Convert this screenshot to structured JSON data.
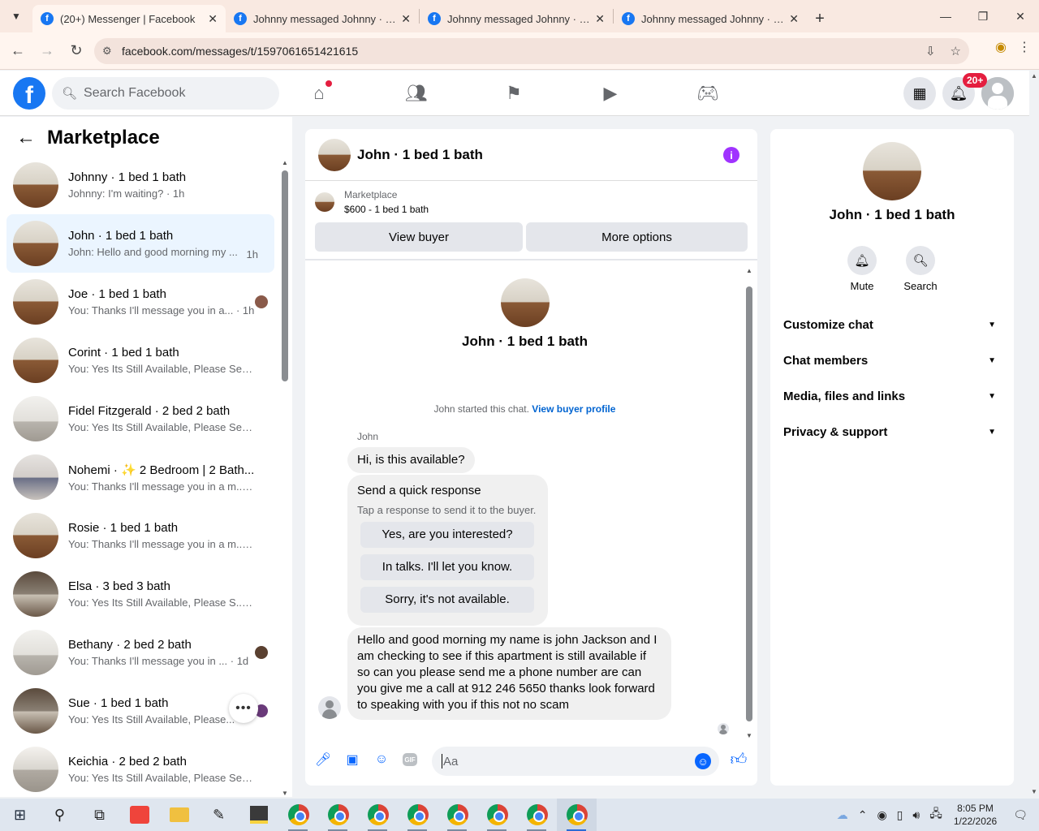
{
  "browser": {
    "tabs": [
      {
        "title": "(20+) Messenger | Facebook",
        "active": true
      },
      {
        "title": "Johnny messaged Johnny · 1 bed 1 bath",
        "active": false
      },
      {
        "title": "Johnny messaged Johnny · 1 bed 1 bath",
        "active": false
      },
      {
        "title": "Johnny messaged Johnny · 1 bed 1 bath",
        "active": false
      }
    ],
    "url": "facebook.com/messages/t/1597061651421615"
  },
  "fb_header": {
    "search_placeholder": "Search Facebook",
    "notification_badge": "20+"
  },
  "sidebar": {
    "title": "Marketplace",
    "conversations": [
      {
        "name": "Johnny · 1 bed 1 bath",
        "preview": "Johnny: I'm waiting? · 1h",
        "time": "",
        "thumb": "room"
      },
      {
        "name": "John · 1 bed 1 bath",
        "preview": "John: Hello and good morning my ...",
        "time": "1h",
        "thumb": "room",
        "selected": true
      },
      {
        "name": "Joe · 1 bed 1 bath",
        "preview": "You: Thanks I'll message you in a... · 1h",
        "time": "",
        "thumb": "room"
      },
      {
        "name": "Corint · 1 bed 1 bath",
        "preview": "You: Yes Its Still Available, Please Se... · 1h",
        "time": "",
        "thumb": "room"
      },
      {
        "name": "Fidel Fitzgerald · 2 bed 2 bath",
        "preview": "You: Yes Its Still Available, Please Se... · 1h",
        "time": "",
        "thumb": "light"
      },
      {
        "name": "Nohemi · ✨ 2 Bedroom | 2 Bath...",
        "preview": "You: Thanks I'll message you in a m... · 1h",
        "time": "",
        "thumb": "bed"
      },
      {
        "name": "Rosie · 1 bed 1 bath",
        "preview": "You: Thanks I'll message you in a m... · 1h",
        "time": "",
        "thumb": "room"
      },
      {
        "name": "Elsa · 3 bed 3 bath",
        "preview": "You: Yes Its Still Available, Please S... · 23h",
        "time": "",
        "thumb": "dark"
      },
      {
        "name": "Bethany · 2 bed 2 bath",
        "preview": "You: Thanks I'll message you in ... · 1d",
        "time": "",
        "thumb": "light"
      },
      {
        "name": "Sue · 1 bed 1 bath",
        "preview": "You: Yes Its Still Available, Please...",
        "time": "",
        "thumb": "dark"
      },
      {
        "name": "Keichia · 2 bed 2 bath",
        "preview": "You: Yes Its Still Available, Please Se... · 2d",
        "time": "",
        "thumb": "win"
      }
    ]
  },
  "chat": {
    "title": "John · 1 bed 1 bath",
    "banner": {
      "label": "Marketplace",
      "price": "$600 - 1 bed 1 bath",
      "view_buyer": "View buyer",
      "more_options": "More options"
    },
    "intro_name": "John · 1 bed 1 bath",
    "started_text": "John started this chat.",
    "view_profile": "View buyer profile",
    "sender": "John",
    "first_message": "Hi, is this available?",
    "quick_response": {
      "title": "Send a quick response",
      "subtitle": "Tap a response to send it to the buyer.",
      "options": [
        "Yes, are you interested?",
        "In talks. I'll let you know.",
        "Sorry, it's not available."
      ]
    },
    "long_message": "Hello and good morning my name is john Jackson and I am checking to see if this apartment is still available if so can you please send me a phone number are can you give me a call at 912 246 5650 thanks look forward to speaking with  you if this not no scam",
    "composer_placeholder": "Aa"
  },
  "info_panel": {
    "name": "John · 1 bed 1 bath",
    "actions": [
      {
        "label": "Mute",
        "icon": "bell-icon"
      },
      {
        "label": "Search",
        "icon": "search-icon"
      }
    ],
    "sections": [
      "Customize chat",
      "Chat members",
      "Media, files and links",
      "Privacy & support"
    ]
  },
  "taskbar": {
    "time": "8:05 PM",
    "date": "1/22/2026"
  }
}
